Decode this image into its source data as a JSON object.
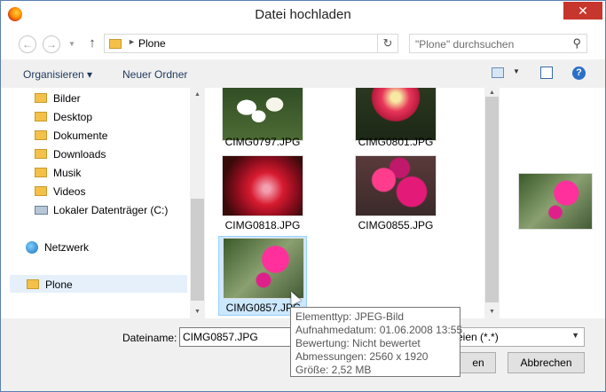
{
  "window": {
    "title": "Datei hochladen",
    "close_label": "✕"
  },
  "nav": {
    "back": "←",
    "forward": "→",
    "up": "↑",
    "breadcrumb": "Plone",
    "crumb_sep": "►",
    "refresh": "↻",
    "search_placeholder": "\"Plone\" durchsuchen",
    "search_icon": "⚲"
  },
  "toolbar": {
    "organize": "Organisieren ▾",
    "new_folder": "Neuer Ordner",
    "help": "?",
    "view_arrow": "▼"
  },
  "sidebar": {
    "items": [
      {
        "label": "Bilder",
        "icon": "folder-icon"
      },
      {
        "label": "Desktop",
        "icon": "folder-icon"
      },
      {
        "label": "Dokumente",
        "icon": "folder-icon"
      },
      {
        "label": "Downloads",
        "icon": "folder-icon"
      },
      {
        "label": "Musik",
        "icon": "folder-icon"
      },
      {
        "label": "Videos",
        "icon": "folder-icon"
      },
      {
        "label": "Lokaler Datenträger (C:)",
        "icon": "drive-icon"
      },
      {
        "label": "Netzwerk",
        "icon": "network-icon"
      },
      {
        "label": "Plone",
        "icon": "folder-icon",
        "selected": true
      }
    ]
  },
  "files": [
    {
      "name": "CIMG0797.JPG"
    },
    {
      "name": "CIMG0801.JPG"
    },
    {
      "name": "CIMG0818.JPG"
    },
    {
      "name": "CIMG0855.JPG"
    },
    {
      "name": "CIMG0857.JPG",
      "selected": true
    }
  ],
  "tooltip": {
    "type": "Elementtyp: JPEG-Bild",
    "date": "Aufnahmedatum: 01.06.2008 13:55",
    "rating": "Bewertung: Nicht bewertet",
    "dims": "Abmessungen: 2560 x 1920",
    "size": "Größe: 2,52 MB"
  },
  "bottom": {
    "filename_label": "Dateiname:",
    "filename_value": "CIMG0857.JPG",
    "filter_value": "eien (*.*)",
    "open_label": "en",
    "cancel_label": "Abbrechen"
  }
}
